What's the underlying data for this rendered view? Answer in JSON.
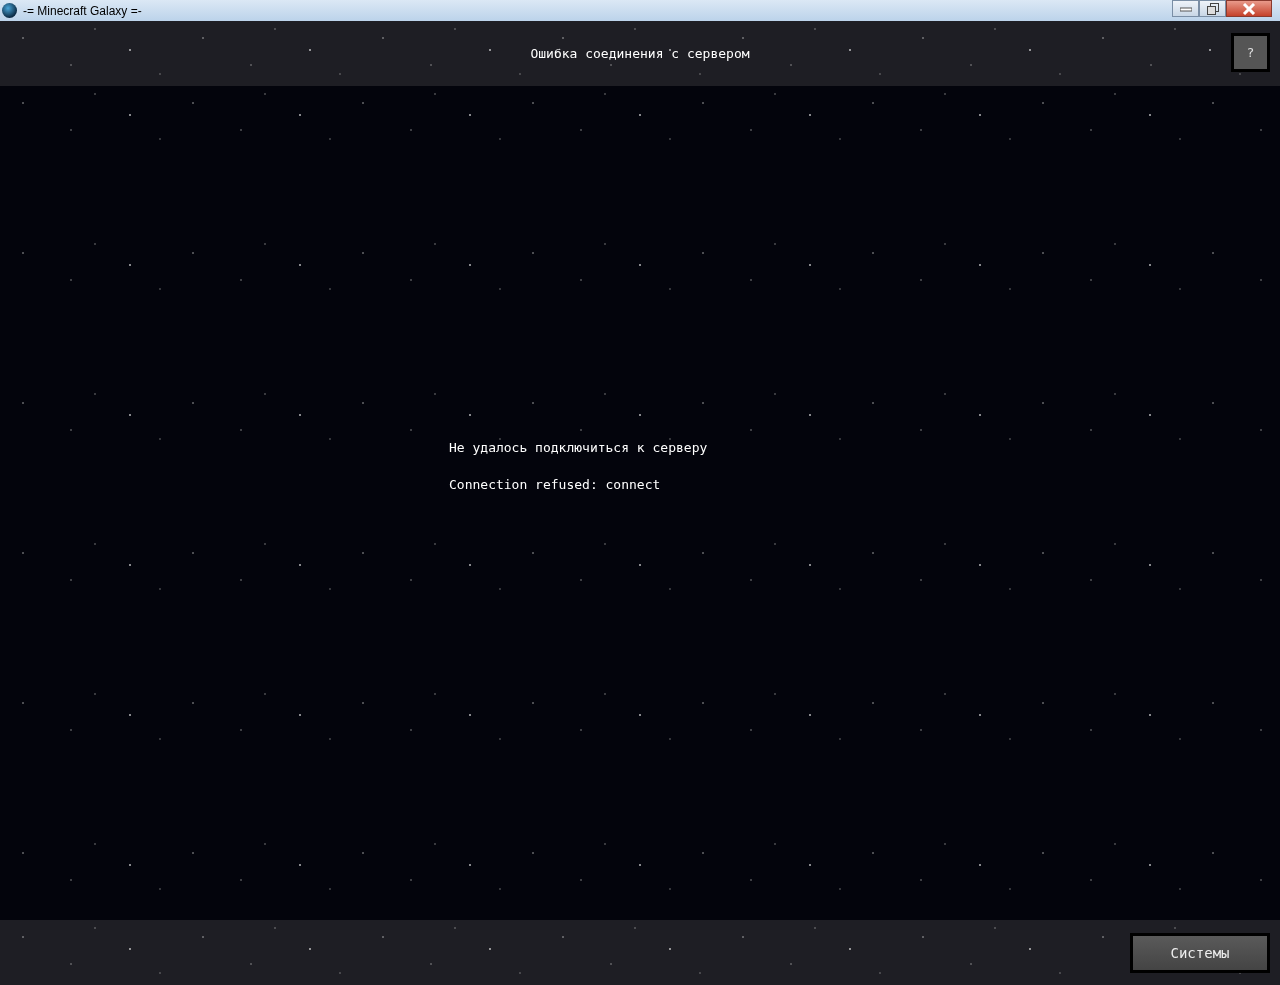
{
  "window": {
    "title": "-= Minecraft Galaxy =-"
  },
  "header": {
    "title": "Ошибка соединения с сервером",
    "help_button": "?"
  },
  "messages": [
    "Не удалось подключиться к серверу",
    "Connection refused: connect"
  ],
  "footer": {
    "button": "Системы"
  }
}
